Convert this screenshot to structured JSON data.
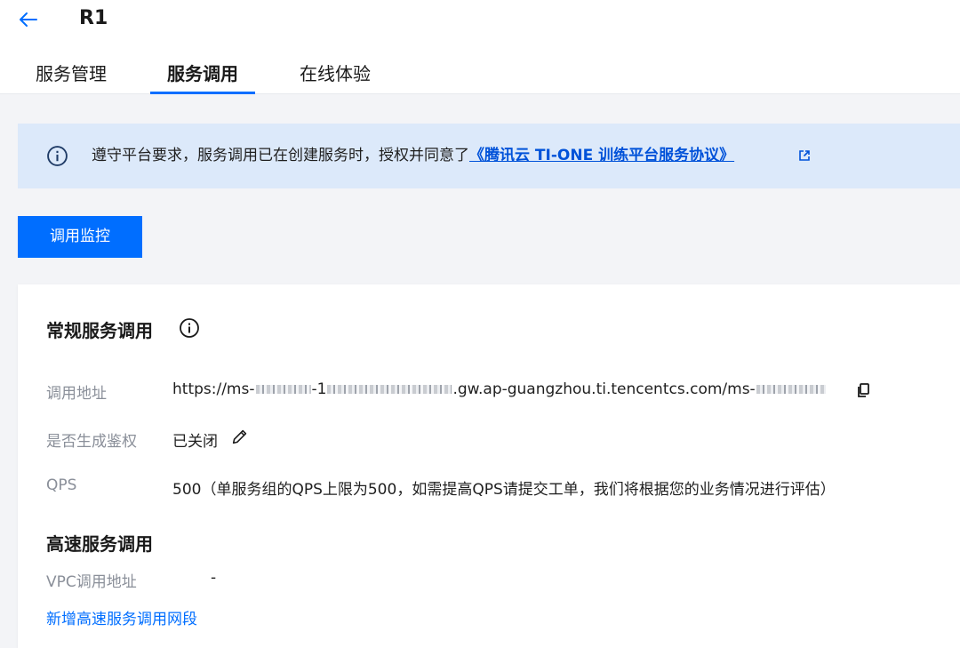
{
  "header": {
    "title": "R1",
    "tabs": [
      {
        "label": "服务管理",
        "active": false
      },
      {
        "label": "服务调用",
        "active": true
      },
      {
        "label": "在线体验",
        "active": false
      }
    ]
  },
  "notice": {
    "text": "遵守平台要求，服务调用已在创建服务时，授权并同意了",
    "link_text": "《腾讯云 TI-ONE 训练平台服务协议》"
  },
  "toolbar": {
    "monitor_label": "调用监控"
  },
  "general_call": {
    "title": "常规服务调用",
    "rows": [
      {
        "label": "调用地址",
        "value_prefix": "https://ms-",
        "value_mid1": "-1",
        "value_mid2": ".gw.ap-guangzhou.ti.tencentcs.com/ms-"
      },
      {
        "label": "是否生成鉴权",
        "value": "已关闭"
      },
      {
        "label": "QPS",
        "value": "500（单服务组的QPS上限为500，如需提高QPS请提交工单，我们将根据您的业务情况进行评估）"
      }
    ]
  },
  "high_speed_call": {
    "title": "高速服务调用",
    "vpc_label": "VPC调用地址",
    "vpc_value": "-",
    "add_link": "新增高速服务调用网段"
  },
  "colors": {
    "accent": "#006eff",
    "link": "#0052d9",
    "notice_bg": "#dce9fa",
    "page_bg": "#f3f4f7"
  }
}
